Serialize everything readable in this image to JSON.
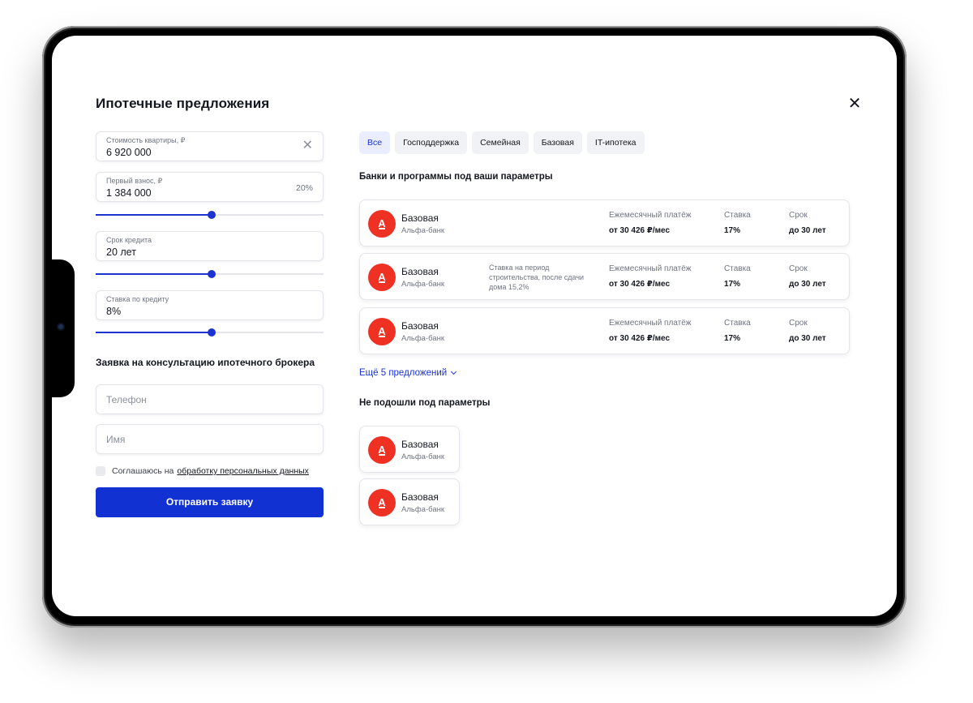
{
  "modal": {
    "title": "Ипотечные предложения",
    "close_glyph": "✕"
  },
  "calculator": {
    "price": {
      "label": "Стоимость квартиры, ₽",
      "value": "6 920 000",
      "clear_glyph": "✕"
    },
    "down_payment": {
      "label": "Первый взнос, ₽",
      "value": "1 384 000",
      "percent": "20%",
      "slider_level": 0.51
    },
    "term": {
      "label": "Срок кредита",
      "value": "20 лет",
      "slider_level": 0.51
    },
    "rate": {
      "label": "Ставка по кредиту",
      "value": "8%",
      "slider_level": 0.51
    }
  },
  "application": {
    "title": "Заявка на консультацию ипотечного брокера",
    "phone_placeholder": "Телефон",
    "name_placeholder": "Имя",
    "consent_text": "Соглашаюсь на",
    "consent_link": "обработку персональных данных",
    "submit_label": "Отправить заявку"
  },
  "tabs": [
    {
      "label": "Все",
      "active": true
    },
    {
      "label": "Господдержка",
      "active": false
    },
    {
      "label": "Семейная",
      "active": false
    },
    {
      "label": "Базовая",
      "active": false
    },
    {
      "label": "IT-ипотека",
      "active": false
    }
  ],
  "matched": {
    "title": "Банки и программы под ваши параметры",
    "column_labels": {
      "payment": "Ежемесячный платёж",
      "rate": "Ставка",
      "term": "Срок"
    },
    "offers": [
      {
        "program": "Базовая",
        "bank": "Альфа-банк",
        "note": "",
        "payment": "от 30 426 ₽/мес",
        "rate": "17%",
        "term": "до 30 лет"
      },
      {
        "program": "Базовая",
        "bank": "Альфа-банк",
        "note": "Ставка на период строительства, после сдачи дома 15,2%",
        "payment": "от 30 426 ₽/мес",
        "rate": "17%",
        "term": "до 30 лет"
      },
      {
        "program": "Базовая",
        "bank": "Альфа-банк",
        "note": "",
        "payment": "от 30 426 ₽/мес",
        "rate": "17%",
        "term": "до 30 лет"
      }
    ],
    "more_label": "Ещё 5 предложений"
  },
  "unmatched": {
    "title": "Не подошли под параметры",
    "offers": [
      {
        "program": "Базовая",
        "bank": "Альфа-банк"
      },
      {
        "program": "Базовая",
        "bank": "Альфа-банк"
      }
    ]
  },
  "bank_logo": {
    "glyph": "А",
    "color": "#ef3124"
  },
  "colors": {
    "accent": "#1a33d1",
    "button": "#1231d3",
    "text": "#14171f",
    "muted": "#6f7480"
  }
}
